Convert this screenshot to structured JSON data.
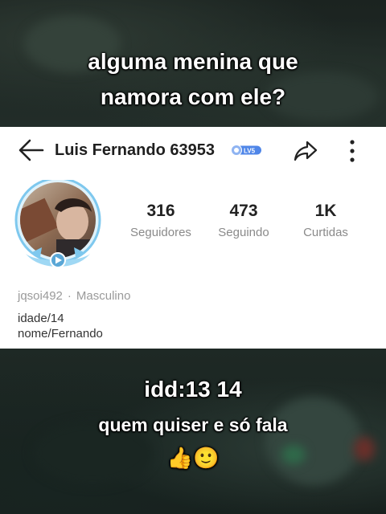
{
  "overlay": {
    "top_caption_line1": "alguma menina que",
    "top_caption_line2": "namora com ele?",
    "bottom_caption_line1": "idd:13 14",
    "bottom_caption_line2": "quem quiser e só fala",
    "bottom_caption_emoji": "👍🙂"
  },
  "profile": {
    "name": "Luis Fernando 63953",
    "level_badge": "LV5",
    "username": "jqsoi492",
    "gender": "Masculino",
    "bio_line1": "idade/14",
    "bio_line2": "nome/Fernando",
    "stats": [
      {
        "value": "316",
        "label": "Seguidores"
      },
      {
        "value": "473",
        "label": "Seguindo"
      },
      {
        "value": "1K",
        "label": "Curtidas"
      }
    ]
  },
  "icons": {
    "back": "arrow-left-icon",
    "share": "share-icon",
    "more": "more-vertical-icon",
    "play": "play-icon"
  },
  "colors": {
    "card_bg": "#ffffff",
    "badge_blue": "#4f86e8",
    "stat_label": "#8a8a8a",
    "avatar_ring": "#7ec8ee"
  }
}
